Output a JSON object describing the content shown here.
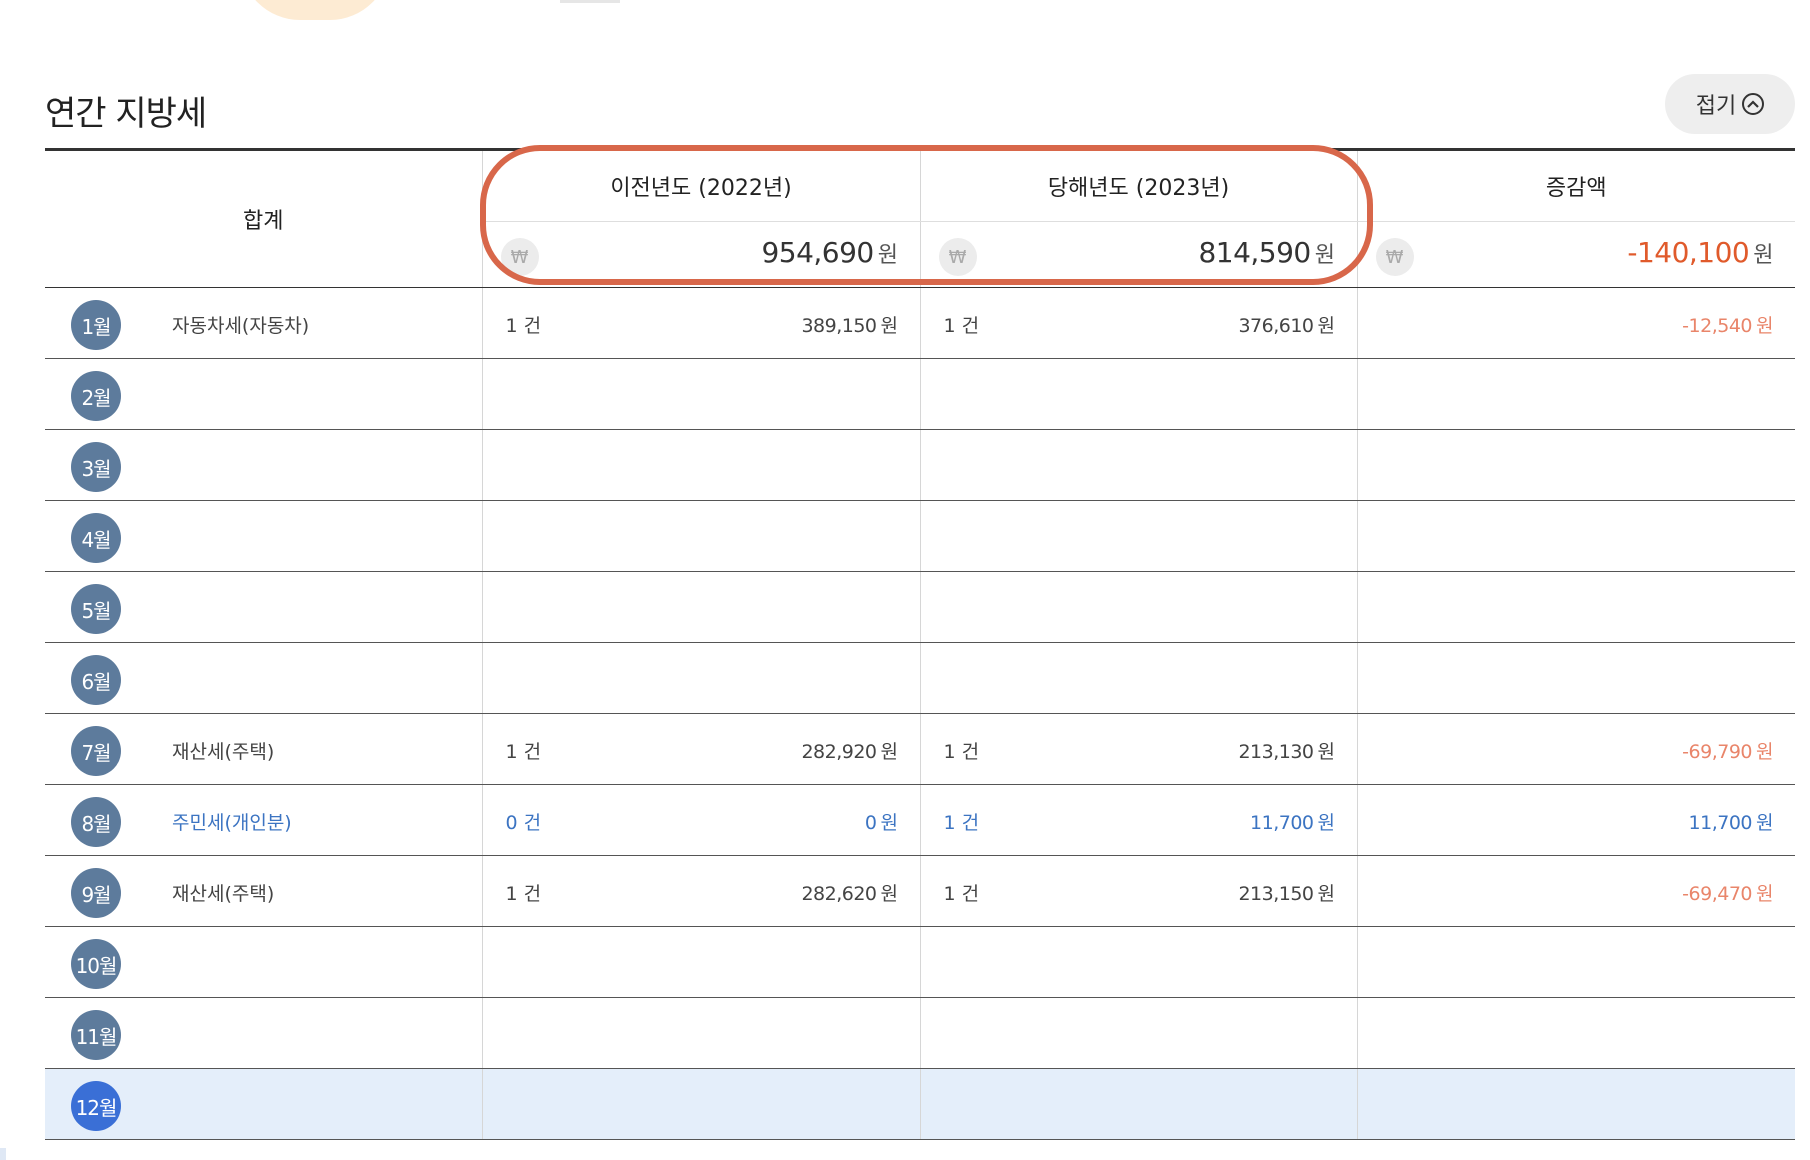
{
  "section": {
    "title": "연간 지방세",
    "fold_label": "접기"
  },
  "header": {
    "sum_label": "합계",
    "prev_year": "이전년도 (2022년)",
    "curr_year": "당해년도 (2023년)",
    "change": "증감액",
    "won_symbol": "₩",
    "unit": "원"
  },
  "totals": {
    "prev": "954,690",
    "curr": "814,590",
    "change": "-140,100"
  },
  "rows": [
    {
      "month": "1월",
      "tax": "자동차세(자동차)",
      "prev_count": "1 건",
      "prev_amount": "389,150",
      "curr_count": "1 건",
      "curr_amount": "376,610",
      "change": "-12,540",
      "unit": "원"
    },
    {
      "month": "2월",
      "tax": "",
      "prev_count": "",
      "prev_amount": "",
      "curr_count": "",
      "curr_amount": "",
      "change": "",
      "unit": ""
    },
    {
      "month": "3월",
      "tax": "",
      "prev_count": "",
      "prev_amount": "",
      "curr_count": "",
      "curr_amount": "",
      "change": "",
      "unit": ""
    },
    {
      "month": "4월",
      "tax": "",
      "prev_count": "",
      "prev_amount": "",
      "curr_count": "",
      "curr_amount": "",
      "change": "",
      "unit": ""
    },
    {
      "month": "5월",
      "tax": "",
      "prev_count": "",
      "prev_amount": "",
      "curr_count": "",
      "curr_amount": "",
      "change": "",
      "unit": ""
    },
    {
      "month": "6월",
      "tax": "",
      "prev_count": "",
      "prev_amount": "",
      "curr_count": "",
      "curr_amount": "",
      "change": "",
      "unit": ""
    },
    {
      "month": "7월",
      "tax": "재산세(주택)",
      "prev_count": "1 건",
      "prev_amount": "282,920",
      "curr_count": "1 건",
      "curr_amount": "213,130",
      "change": "-69,790",
      "unit": "원"
    },
    {
      "month": "8월",
      "tax": "주민세(개인분)",
      "prev_count": "0 건",
      "prev_amount": "0",
      "curr_count": "1 건",
      "curr_amount": "11,700",
      "change": "11,700",
      "unit": "원"
    },
    {
      "month": "9월",
      "tax": "재산세(주택)",
      "prev_count": "1 건",
      "prev_amount": "282,620",
      "curr_count": "1 건",
      "curr_amount": "213,150",
      "change": "-69,470",
      "unit": "원"
    },
    {
      "month": "10월",
      "tax": "",
      "prev_count": "",
      "prev_amount": "",
      "curr_count": "",
      "curr_amount": "",
      "change": "",
      "unit": ""
    },
    {
      "month": "11월",
      "tax": "",
      "prev_count": "",
      "prev_amount": "",
      "curr_count": "",
      "curr_amount": "",
      "change": "",
      "unit": ""
    },
    {
      "month": "12월",
      "tax": "",
      "prev_count": "",
      "prev_amount": "",
      "curr_count": "",
      "curr_amount": "",
      "change": "",
      "unit": ""
    }
  ],
  "colors": {
    "badge": "#5d7b9c",
    "badge_active": "#3a6fd6",
    "negative": "#e05a2b",
    "positive_blue": "#3c74c2",
    "highlight_ring": "#d8674a",
    "active_row_bg": "#e4eefa"
  },
  "icons": {
    "fold": "chevron-up-circle-icon",
    "won": "won-icon"
  }
}
